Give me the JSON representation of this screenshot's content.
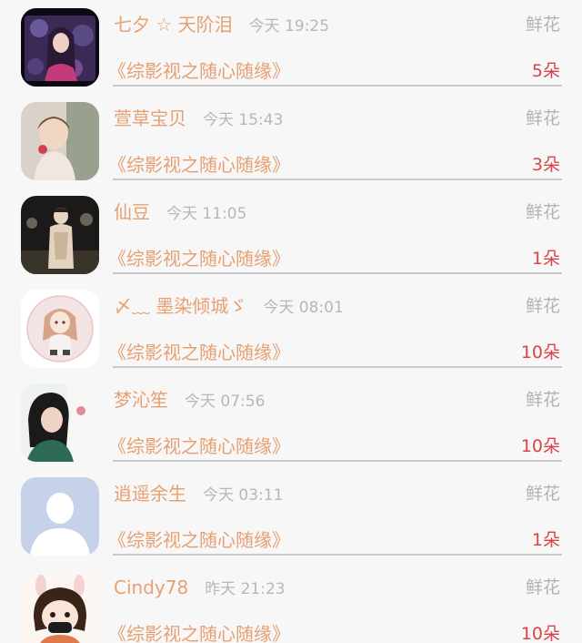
{
  "gift_label": "鲜花",
  "items": [
    {
      "name": "七夕 ☆ 天阶泪",
      "time": "今天 19:25",
      "title": "《综影视之随心随缘》",
      "count": "5朵"
    },
    {
      "name": "萱草宝贝",
      "time": "今天 15:43",
      "title": "《综影视之随心随缘》",
      "count": "3朵"
    },
    {
      "name": "仙豆",
      "time": "今天 11:05",
      "title": "《综影视之随心随缘》",
      "count": "1朵"
    },
    {
      "name": "〆﹏ 墨染倾城ゞ",
      "time": "今天 08:01",
      "title": "《综影视之随心随缘》",
      "count": "10朵"
    },
    {
      "name": "梦沁笙",
      "time": "今天 07:56",
      "title": "《综影视之随心随缘》",
      "count": "10朵"
    },
    {
      "name": "逍遥余生",
      "time": "今天 03:11",
      "title": "《综影视之随心随缘》",
      "count": "1朵"
    },
    {
      "name": "Cindy78",
      "time": "昨天 21:23",
      "title": "《综影视之随心随缘》",
      "count": "10朵"
    }
  ]
}
